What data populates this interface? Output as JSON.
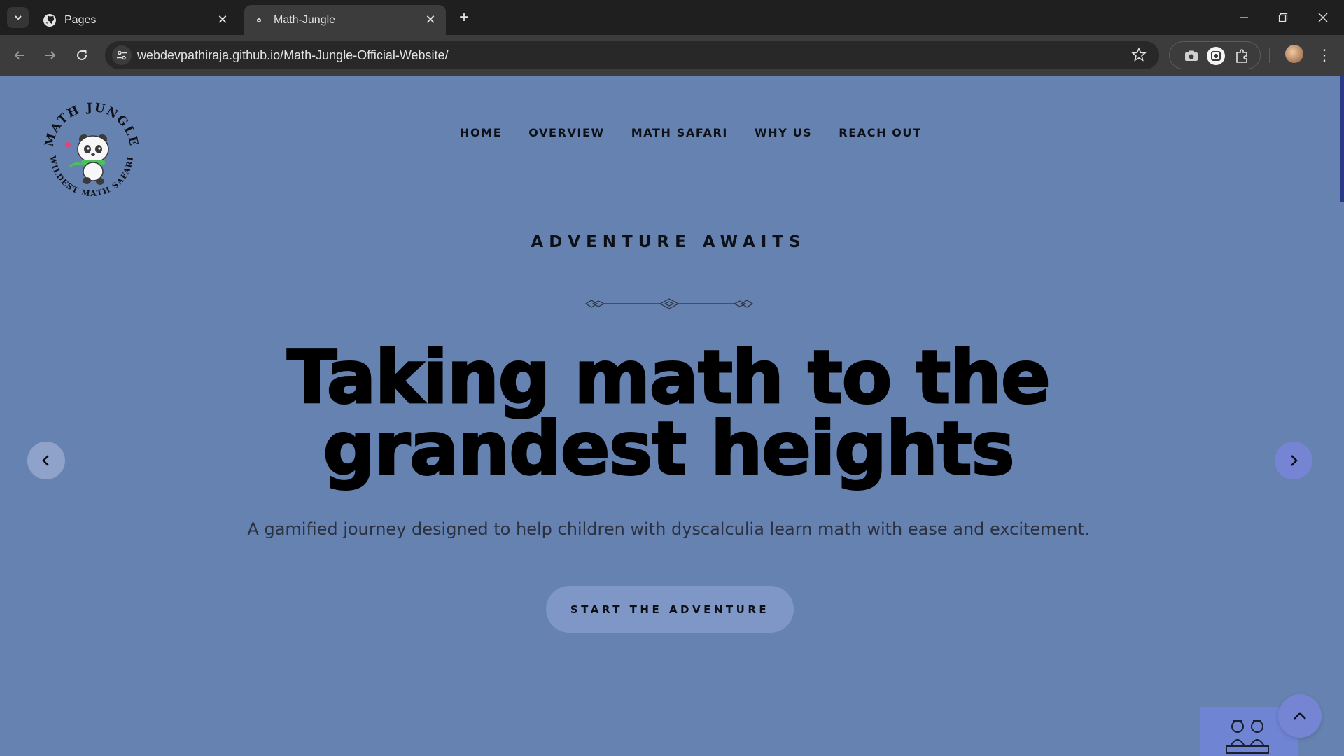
{
  "browser": {
    "tabs": [
      {
        "title": "Pages",
        "active": false,
        "favicon": "github-icon"
      },
      {
        "title": "Math-Jungle",
        "active": true,
        "favicon": "panda-favicon"
      }
    ],
    "url": "webdevpathiraja.github.io/Math-Jungle-Official-Website/"
  },
  "site": {
    "logo": {
      "top_text": "MATH JUNGLE",
      "bottom_text": "WILDEST MATH SAFARI"
    },
    "nav": [
      "HOME",
      "OVERVIEW",
      "MATH SAFARI",
      "WHY US",
      "REACH OUT"
    ],
    "hero": {
      "eyebrow": "ADVENTURE AWAITS",
      "headline_line1": "Taking math to the",
      "headline_line2": "grandest heights",
      "subtitle": "A gamified journey designed to help children with dyscalculia learn math with ease and excitement.",
      "cta": "START THE ADVENTURE"
    }
  },
  "colors": {
    "page_bg": "#6682b0",
    "cta_bg": "#7f97c6",
    "accent": "#7585d3"
  }
}
